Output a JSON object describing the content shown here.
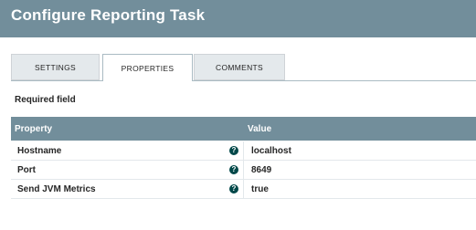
{
  "dialog": {
    "title": "Configure Reporting Task"
  },
  "tabs": [
    {
      "label": "SETTINGS",
      "active": false
    },
    {
      "label": "PROPERTIES",
      "active": true
    },
    {
      "label": "COMMENTS",
      "active": false
    }
  ],
  "required_label": "Required field",
  "grid": {
    "headers": {
      "property": "Property",
      "value": "Value"
    },
    "rows": [
      {
        "name": "Hostname",
        "value": "localhost",
        "help_icon": "help-icon"
      },
      {
        "name": "Port",
        "value": "8649",
        "help_icon": "help-icon"
      },
      {
        "name": "Send JVM Metrics",
        "value": "true",
        "help_icon": "help-icon"
      }
    ]
  },
  "colors": {
    "header_bg": "#728e9b",
    "help_icon": "#004849"
  }
}
